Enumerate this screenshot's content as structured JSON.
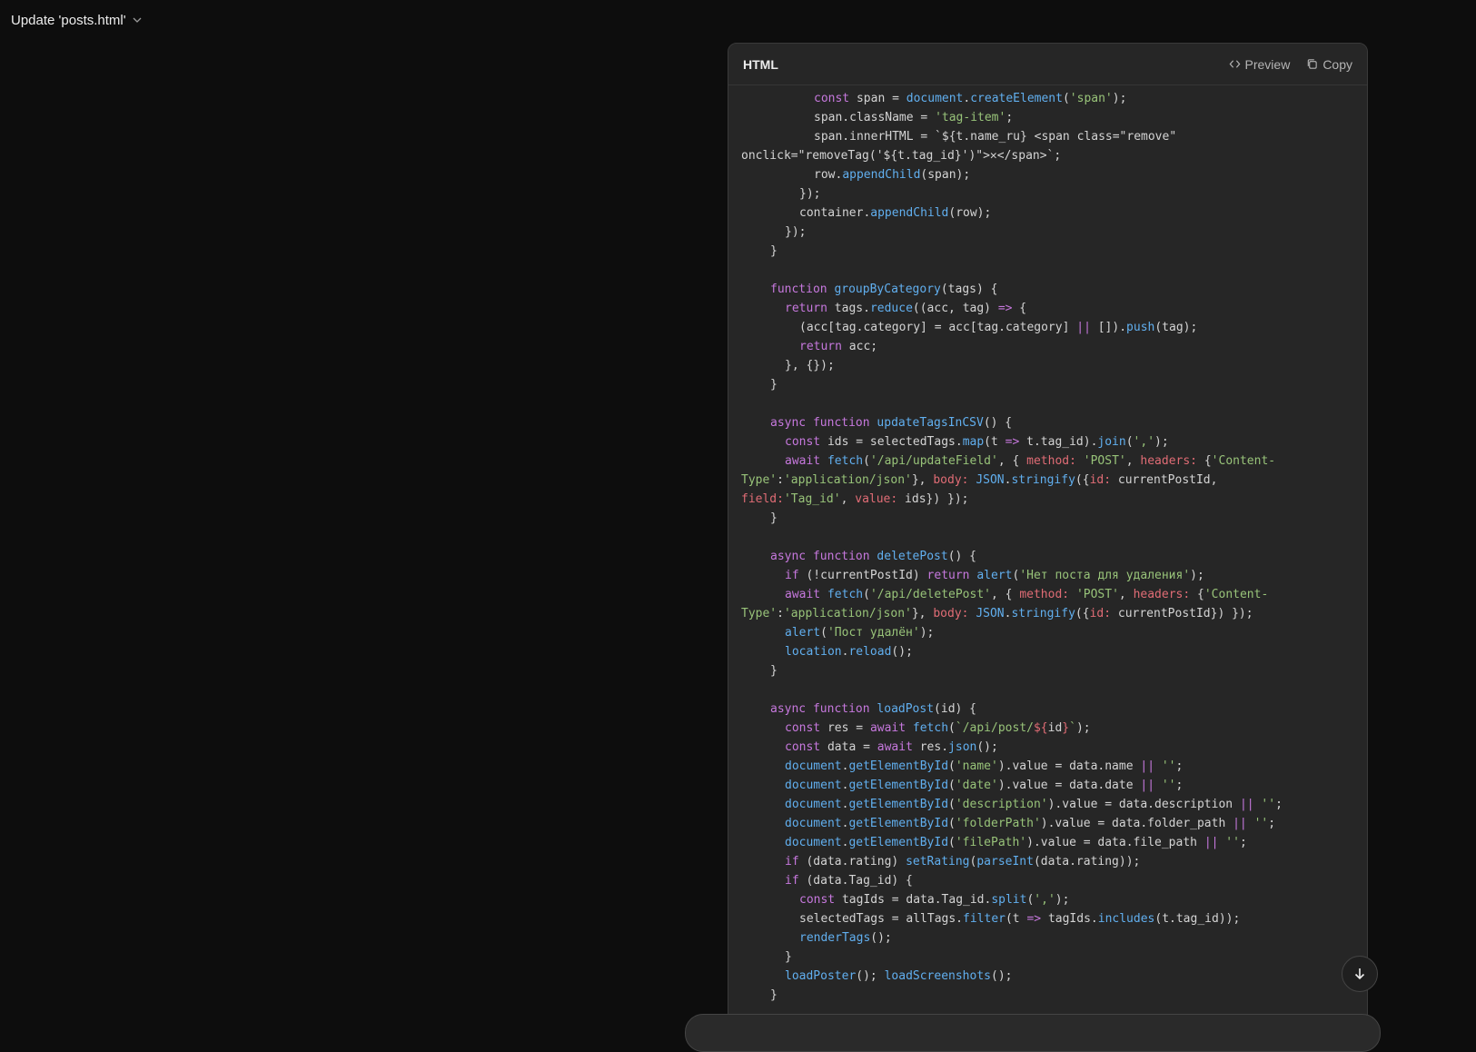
{
  "topbar": {
    "title": "Update 'posts.html'"
  },
  "panel": {
    "title": "HTML",
    "preview_label": "Preview",
    "copy_label": "Copy"
  },
  "code_lines": [
    [
      {
        "t": "      "
      },
      {
        "t": "const",
        "c": "kw"
      },
      {
        "t": " span = "
      },
      {
        "t": "document",
        "c": "fn"
      },
      {
        "t": "."
      },
      {
        "t": "createElement",
        "c": "fn"
      },
      {
        "t": "("
      },
      {
        "t": "'span'",
        "c": "st"
      },
      {
        "t": ");"
      }
    ],
    [
      {
        "t": "      span.className = "
      },
      {
        "t": "'tag-item'",
        "c": "st"
      },
      {
        "t": ";"
      }
    ],
    [
      {
        "t": "      span.innerHTML = `${t.name_ru} <span class=\"remove\""
      }
    ],
    [
      {
        "t": "onclick=\"removeTag('${t.tag_id}')\">✕</span>`;"
      }
    ],
    [
      {
        "t": "      row."
      },
      {
        "t": "appendChild",
        "c": "fn"
      },
      {
        "t": "(span);"
      }
    ],
    [
      {
        "t": "    });"
      }
    ],
    [
      {
        "t": "    container."
      },
      {
        "t": "appendChild",
        "c": "fn"
      },
      {
        "t": "(row);"
      }
    ],
    [
      {
        "t": "  });"
      }
    ],
    [
      {
        "t": "}"
      }
    ],
    [
      {
        "t": ""
      }
    ],
    [
      {
        "t": "function",
        "c": "kw"
      },
      {
        "t": " "
      },
      {
        "t": "groupByCategory",
        "c": "fn"
      },
      {
        "t": "(tags) {"
      }
    ],
    [
      {
        "t": "  "
      },
      {
        "t": "return",
        "c": "kw"
      },
      {
        "t": " tags."
      },
      {
        "t": "reduce",
        "c": "fn"
      },
      {
        "t": "((acc, tag) "
      },
      {
        "t": "=>",
        "c": "op"
      },
      {
        "t": " {"
      }
    ],
    [
      {
        "t": "    (acc[tag.category] = acc[tag.category] "
      },
      {
        "t": "||",
        "c": "op"
      },
      {
        "t": " [])."
      },
      {
        "t": "push",
        "c": "fn"
      },
      {
        "t": "(tag);"
      }
    ],
    [
      {
        "t": "    "
      },
      {
        "t": "return",
        "c": "kw"
      },
      {
        "t": " acc;"
      }
    ],
    [
      {
        "t": "  }, {});"
      }
    ],
    [
      {
        "t": "}"
      }
    ],
    [
      {
        "t": ""
      }
    ],
    [
      {
        "t": "async",
        "c": "kw"
      },
      {
        "t": " "
      },
      {
        "t": "function",
        "c": "kw"
      },
      {
        "t": " "
      },
      {
        "t": "updateTagsInCSV",
        "c": "fn"
      },
      {
        "t": "() {"
      }
    ],
    [
      {
        "t": "  "
      },
      {
        "t": "const",
        "c": "kw"
      },
      {
        "t": " ids = selectedTags."
      },
      {
        "t": "map",
        "c": "fn"
      },
      {
        "t": "(t "
      },
      {
        "t": "=>",
        "c": "op"
      },
      {
        "t": " t.tag_id)."
      },
      {
        "t": "join",
        "c": "fn"
      },
      {
        "t": "("
      },
      {
        "t": "','",
        "c": "st"
      },
      {
        "t": ");"
      }
    ],
    [
      {
        "t": "  "
      },
      {
        "t": "await",
        "c": "kw"
      },
      {
        "t": " "
      },
      {
        "t": "fetch",
        "c": "fn"
      },
      {
        "t": "("
      },
      {
        "t": "'/api/updateField'",
        "c": "st"
      },
      {
        "t": ", { "
      },
      {
        "t": "method:",
        "c": "pr"
      },
      {
        "t": " "
      },
      {
        "t": "'POST'",
        "c": "st"
      },
      {
        "t": ", "
      },
      {
        "t": "headers:",
        "c": "pr"
      },
      {
        "t": " {"
      },
      {
        "t": "'Content-",
        "c": "st"
      }
    ],
    [
      {
        "t": "Type'",
        "c": "st"
      },
      {
        "t": ":"
      },
      {
        "t": "'application/json'",
        "c": "st"
      },
      {
        "t": "}, "
      },
      {
        "t": "body:",
        "c": "pr"
      },
      {
        "t": " "
      },
      {
        "t": "JSON",
        "c": "fn"
      },
      {
        "t": "."
      },
      {
        "t": "stringify",
        "c": "fn"
      },
      {
        "t": "({"
      },
      {
        "t": "id:",
        "c": "pr"
      },
      {
        "t": " currentPostId,"
      }
    ],
    [
      {
        "t": "field:",
        "c": "pr"
      },
      {
        "t": "'Tag_id'",
        "c": "st"
      },
      {
        "t": ", "
      },
      {
        "t": "value:",
        "c": "pr"
      },
      {
        "t": " ids}) });"
      }
    ],
    [
      {
        "t": "}"
      }
    ],
    [
      {
        "t": ""
      }
    ],
    [
      {
        "t": "async",
        "c": "kw"
      },
      {
        "t": " "
      },
      {
        "t": "function",
        "c": "kw"
      },
      {
        "t": " "
      },
      {
        "t": "deletePost",
        "c": "fn"
      },
      {
        "t": "() {"
      }
    ],
    [
      {
        "t": "  "
      },
      {
        "t": "if",
        "c": "kw"
      },
      {
        "t": " (!currentPostId) "
      },
      {
        "t": "return",
        "c": "kw"
      },
      {
        "t": " "
      },
      {
        "t": "alert",
        "c": "fn"
      },
      {
        "t": "("
      },
      {
        "t": "'Нет поста для удаления'",
        "c": "st"
      },
      {
        "t": ");"
      }
    ],
    [
      {
        "t": "  "
      },
      {
        "t": "await",
        "c": "kw"
      },
      {
        "t": " "
      },
      {
        "t": "fetch",
        "c": "fn"
      },
      {
        "t": "("
      },
      {
        "t": "'/api/deletePost'",
        "c": "st"
      },
      {
        "t": ", { "
      },
      {
        "t": "method:",
        "c": "pr"
      },
      {
        "t": " "
      },
      {
        "t": "'POST'",
        "c": "st"
      },
      {
        "t": ", "
      },
      {
        "t": "headers:",
        "c": "pr"
      },
      {
        "t": " {"
      },
      {
        "t": "'Content-",
        "c": "st"
      }
    ],
    [
      {
        "t": "Type'",
        "c": "st"
      },
      {
        "t": ":"
      },
      {
        "t": "'application/json'",
        "c": "st"
      },
      {
        "t": "}, "
      },
      {
        "t": "body:",
        "c": "pr"
      },
      {
        "t": " "
      },
      {
        "t": "JSON",
        "c": "fn"
      },
      {
        "t": "."
      },
      {
        "t": "stringify",
        "c": "fn"
      },
      {
        "t": "({"
      },
      {
        "t": "id:",
        "c": "pr"
      },
      {
        "t": " currentPostId}) });"
      }
    ],
    [
      {
        "t": "  "
      },
      {
        "t": "alert",
        "c": "fn"
      },
      {
        "t": "("
      },
      {
        "t": "'Пост удалён'",
        "c": "st"
      },
      {
        "t": ");"
      }
    ],
    [
      {
        "t": "  "
      },
      {
        "t": "location",
        "c": "fn"
      },
      {
        "t": "."
      },
      {
        "t": "reload",
        "c": "fn"
      },
      {
        "t": "();"
      }
    ],
    [
      {
        "t": "}"
      }
    ],
    [
      {
        "t": ""
      }
    ],
    [
      {
        "t": "async",
        "c": "kw"
      },
      {
        "t": " "
      },
      {
        "t": "function",
        "c": "kw"
      },
      {
        "t": " "
      },
      {
        "t": "loadPost",
        "c": "fn"
      },
      {
        "t": "(id) {"
      }
    ],
    [
      {
        "t": "  "
      },
      {
        "t": "const",
        "c": "kw"
      },
      {
        "t": " res = "
      },
      {
        "t": "await",
        "c": "kw"
      },
      {
        "t": " "
      },
      {
        "t": "fetch",
        "c": "fn"
      },
      {
        "t": "("
      },
      {
        "t": "`/api/post/",
        "c": "st"
      },
      {
        "t": "${",
        "c": "pr"
      },
      {
        "t": "id"
      },
      {
        "t": "}",
        "c": "pr"
      },
      {
        "t": "`",
        "c": "st"
      },
      {
        "t": ");"
      }
    ],
    [
      {
        "t": "  "
      },
      {
        "t": "const",
        "c": "kw"
      },
      {
        "t": " data = "
      },
      {
        "t": "await",
        "c": "kw"
      },
      {
        "t": " res."
      },
      {
        "t": "json",
        "c": "fn"
      },
      {
        "t": "();"
      }
    ],
    [
      {
        "t": "  "
      },
      {
        "t": "document",
        "c": "fn"
      },
      {
        "t": "."
      },
      {
        "t": "getElementById",
        "c": "fn"
      },
      {
        "t": "("
      },
      {
        "t": "'name'",
        "c": "st"
      },
      {
        "t": ").value = data.name "
      },
      {
        "t": "||",
        "c": "op"
      },
      {
        "t": " "
      },
      {
        "t": "''",
        "c": "st"
      },
      {
        "t": ";"
      }
    ],
    [
      {
        "t": "  "
      },
      {
        "t": "document",
        "c": "fn"
      },
      {
        "t": "."
      },
      {
        "t": "getElementById",
        "c": "fn"
      },
      {
        "t": "("
      },
      {
        "t": "'date'",
        "c": "st"
      },
      {
        "t": ").value = data.date "
      },
      {
        "t": "||",
        "c": "op"
      },
      {
        "t": " "
      },
      {
        "t": "''",
        "c": "st"
      },
      {
        "t": ";"
      }
    ],
    [
      {
        "t": "  "
      },
      {
        "t": "document",
        "c": "fn"
      },
      {
        "t": "."
      },
      {
        "t": "getElementById",
        "c": "fn"
      },
      {
        "t": "("
      },
      {
        "t": "'description'",
        "c": "st"
      },
      {
        "t": ").value = data.description "
      },
      {
        "t": "||",
        "c": "op"
      },
      {
        "t": " "
      },
      {
        "t": "''",
        "c": "st"
      },
      {
        "t": ";"
      }
    ],
    [
      {
        "t": "  "
      },
      {
        "t": "document",
        "c": "fn"
      },
      {
        "t": "."
      },
      {
        "t": "getElementById",
        "c": "fn"
      },
      {
        "t": "("
      },
      {
        "t": "'folderPath'",
        "c": "st"
      },
      {
        "t": ").value = data.folder_path "
      },
      {
        "t": "||",
        "c": "op"
      },
      {
        "t": " "
      },
      {
        "t": "''",
        "c": "st"
      },
      {
        "t": ";"
      }
    ],
    [
      {
        "t": "  "
      },
      {
        "t": "document",
        "c": "fn"
      },
      {
        "t": "."
      },
      {
        "t": "getElementById",
        "c": "fn"
      },
      {
        "t": "("
      },
      {
        "t": "'filePath'",
        "c": "st"
      },
      {
        "t": ").value = data.file_path "
      },
      {
        "t": "||",
        "c": "op"
      },
      {
        "t": " "
      },
      {
        "t": "''",
        "c": "st"
      },
      {
        "t": ";"
      }
    ],
    [
      {
        "t": "  "
      },
      {
        "t": "if",
        "c": "kw"
      },
      {
        "t": " (data.rating) "
      },
      {
        "t": "setRating",
        "c": "fn"
      },
      {
        "t": "("
      },
      {
        "t": "parseInt",
        "c": "fn"
      },
      {
        "t": "(data.rating));"
      }
    ],
    [
      {
        "t": "  "
      },
      {
        "t": "if",
        "c": "kw"
      },
      {
        "t": " (data.Tag_id) {"
      }
    ],
    [
      {
        "t": "    "
      },
      {
        "t": "const",
        "c": "kw"
      },
      {
        "t": " tagIds = data.Tag_id."
      },
      {
        "t": "split",
        "c": "fn"
      },
      {
        "t": "("
      },
      {
        "t": "','",
        "c": "st"
      },
      {
        "t": ");"
      }
    ],
    [
      {
        "t": "    selectedTags = allTags."
      },
      {
        "t": "filter",
        "c": "fn"
      },
      {
        "t": "(t "
      },
      {
        "t": "=>",
        "c": "op"
      },
      {
        "t": " tagIds."
      },
      {
        "t": "includes",
        "c": "fn"
      },
      {
        "t": "(t.tag_id));"
      }
    ],
    [
      {
        "t": "    "
      },
      {
        "t": "renderTags",
        "c": "fn"
      },
      {
        "t": "();"
      }
    ],
    [
      {
        "t": "  }"
      }
    ],
    [
      {
        "t": "  "
      },
      {
        "t": "loadPoster",
        "c": "fn"
      },
      {
        "t": "(); "
      },
      {
        "t": "loadScreenshots",
        "c": "fn"
      },
      {
        "t": "();"
      }
    ],
    [
      {
        "t": "}"
      }
    ]
  ]
}
